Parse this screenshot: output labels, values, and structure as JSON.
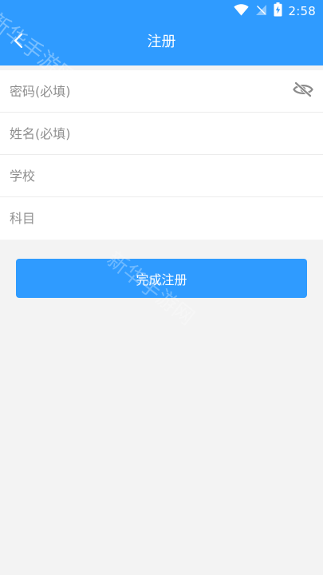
{
  "status_bar": {
    "time": "2:58",
    "icons": [
      "wifi-icon",
      "signal-icon",
      "battery-charging-icon"
    ]
  },
  "header": {
    "title": "注册",
    "back_icon": "back-chevron-icon"
  },
  "form": {
    "password_placeholder": "密码(必填)",
    "name_placeholder": "姓名(必填)",
    "school_placeholder": "学校",
    "subject_placeholder": "科目",
    "password_visibility_icon": "eye-off-icon"
  },
  "submit_button": {
    "label": "完成注册"
  },
  "watermark": {
    "text": "新华手游网"
  },
  "colors": {
    "primary": "#2f9bff",
    "background": "#f3f3f3",
    "placeholder": "#8f8f8f",
    "eye_icon": "#8a8a8a"
  }
}
